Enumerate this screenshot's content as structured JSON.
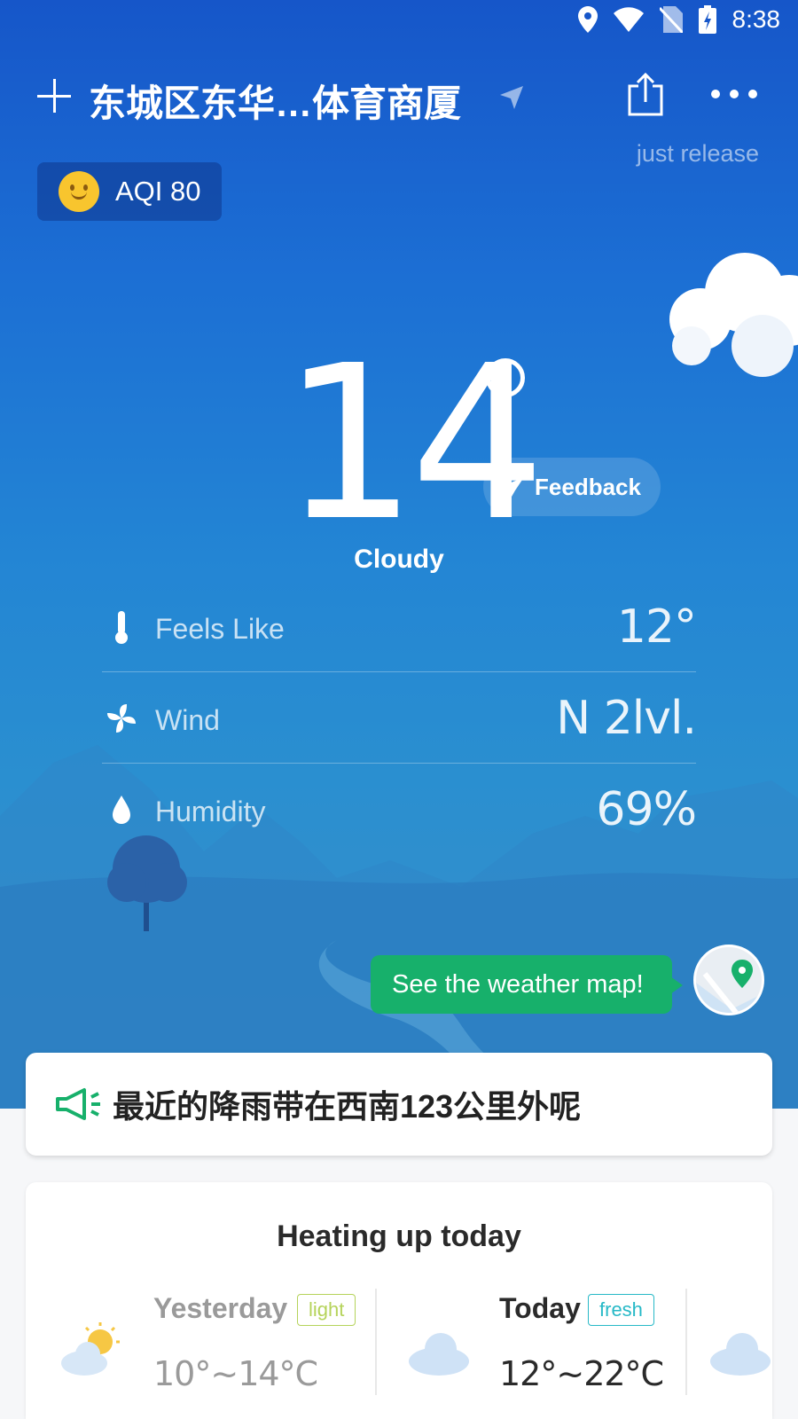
{
  "status_bar": {
    "time": "8:38"
  },
  "header": {
    "city": "东城区东华…体育商厦",
    "release": "just release"
  },
  "aqi": {
    "label": "AQI 80"
  },
  "current": {
    "temperature": "14",
    "condition": "Cloudy",
    "feedback_label": "Feedback"
  },
  "details": [
    {
      "name": "Feels Like",
      "value": "12°",
      "icon": "thermometer-icon"
    },
    {
      "name": "Wind",
      "value": "N 2lvl.",
      "icon": "fan-icon"
    },
    {
      "name": "Humidity",
      "value": "69%",
      "icon": "droplet-icon"
    }
  ],
  "map_tip": "See the weather map!",
  "notice": {
    "text": "最近的降雨带在西南123公里外呢"
  },
  "forecast": {
    "title": "Heating up today",
    "days": [
      {
        "name": "Yesterday",
        "tag": "light",
        "range": "10°~14°C",
        "icon": "partly-sunny-icon"
      },
      {
        "name": "Today",
        "tag": "fresh",
        "range": "12°~22°C",
        "icon": "cloud-icon"
      }
    ]
  },
  "colors": {
    "sky_top": "#1656c9",
    "sky_bottom": "#3a8fc8",
    "accent_green": "#17b06b",
    "tag_light": "#b5d35a",
    "tag_fresh": "#27b9c7"
  }
}
